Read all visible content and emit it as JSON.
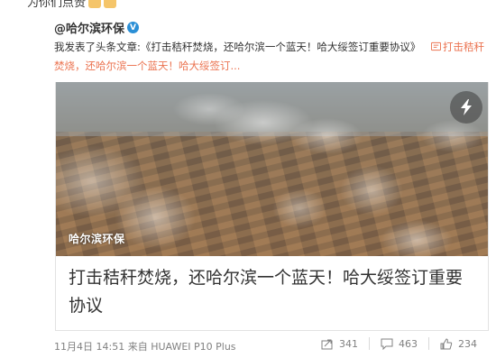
{
  "top_partial_text": "为你们点赞",
  "author": {
    "name": "@哈尔滨环保",
    "verified_label": "V"
  },
  "post": {
    "prefix": "我发表了头条文章:",
    "article_title_quoted": "《打击秸秆焚烧，还哈尔滨一个蓝天！哈大绥签订重要协议》",
    "link_text": "打击秸秆焚烧，还哈尔滨一个蓝天！哈大绥签订..."
  },
  "card": {
    "cover_caption": "哈尔滨环保",
    "headline": "打击秸秆焚烧，还哈尔滨一个蓝天！哈大绥签订重要协议",
    "action_icon": "lightning-icon"
  },
  "footer": {
    "date": "11月4日 14:51",
    "source_prefix": "来自",
    "device": "HUAWEI P10 Plus"
  },
  "actions": {
    "forward": 341,
    "comment": 463,
    "like": 234
  },
  "colors": {
    "link": "#eb7350",
    "text": "#333333",
    "meta": "#808080",
    "verified": "#2b8fd6"
  }
}
